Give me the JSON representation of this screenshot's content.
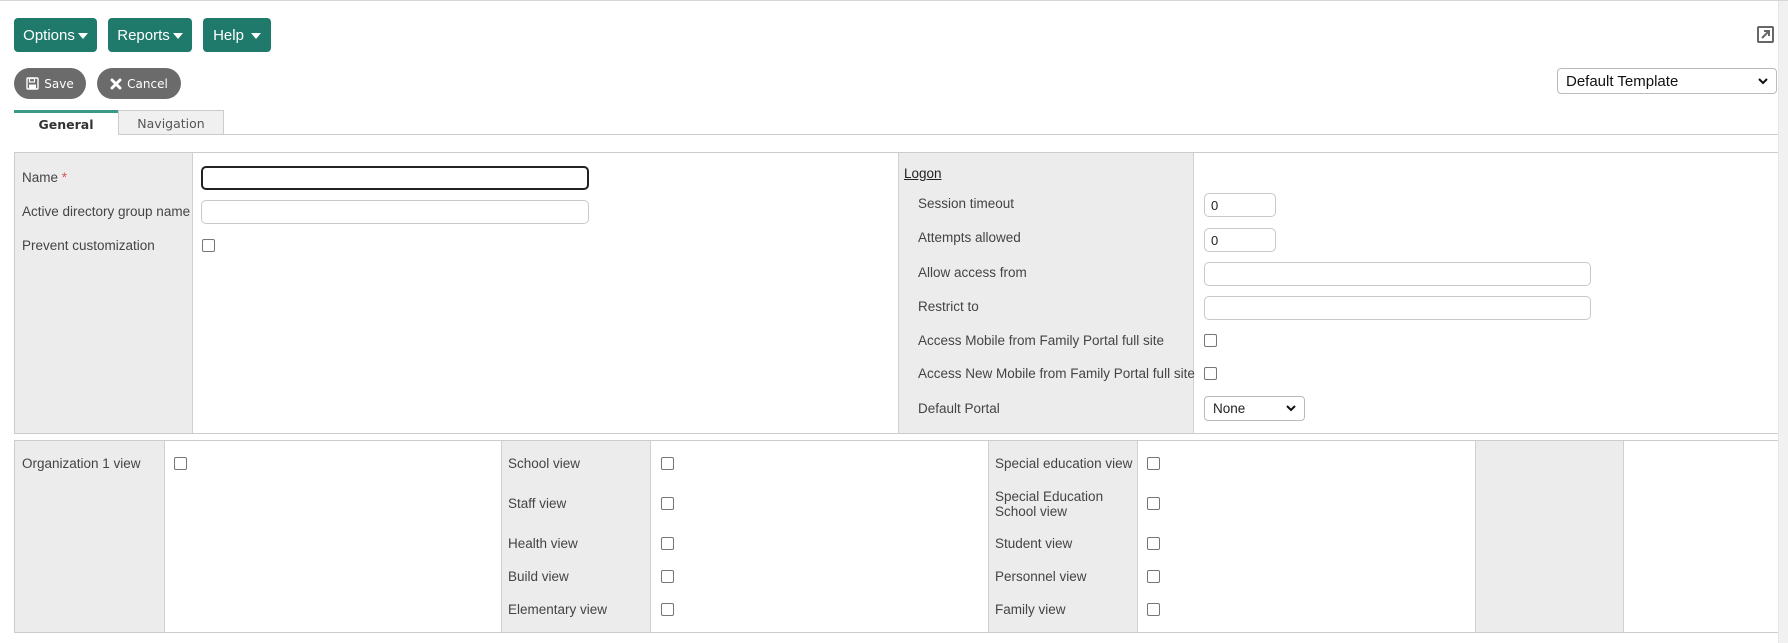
{
  "toolbar": {
    "menus": [
      {
        "label": "Options"
      },
      {
        "label": "Reports"
      },
      {
        "label": "Help"
      }
    ],
    "save_label": "Save",
    "cancel_label": "Cancel",
    "template_select": {
      "selected": "Default Template"
    }
  },
  "tabs": [
    {
      "label": "General",
      "active": true
    },
    {
      "label": "Navigation",
      "active": false
    }
  ],
  "general": {
    "name_label": "Name",
    "name_required": "*",
    "name_value": "",
    "ad_group_label": "Active directory group name",
    "ad_group_value": "",
    "prevent_customization_label": "Prevent customization",
    "prevent_customization_checked": false
  },
  "logon": {
    "title": "Logon",
    "session_timeout_label": "Session timeout",
    "session_timeout_value": "0",
    "attempts_allowed_label": "Attempts allowed",
    "attempts_allowed_value": "0",
    "allow_access_from_label": "Allow access from",
    "allow_access_from_value": "",
    "restrict_to_label": "Restrict to",
    "restrict_to_value": "",
    "access_mobile_label": "Access Mobile from Family Portal full site",
    "access_new_mobile_label": "Access New Mobile from Family Portal full site",
    "default_portal_label": "Default Portal",
    "default_portal_value": "None"
  },
  "views": {
    "col1": [
      {
        "label": "Organization 1 view",
        "checked": false
      }
    ],
    "col2": [
      {
        "label": "School view",
        "checked": false
      },
      {
        "label": "Staff view",
        "checked": false
      },
      {
        "label": "Health view",
        "checked": false
      },
      {
        "label": "Build view",
        "checked": false
      },
      {
        "label": "Elementary view",
        "checked": false
      }
    ],
    "col3": [
      {
        "label": "Special education view",
        "checked": false
      },
      {
        "label": "Special Education School view",
        "line1": "Special Education",
        "line2": "School view",
        "checked": false
      },
      {
        "label": "Student view",
        "checked": false
      },
      {
        "label": "Personnel view",
        "checked": false
      },
      {
        "label": "Family view",
        "checked": false
      }
    ]
  }
}
